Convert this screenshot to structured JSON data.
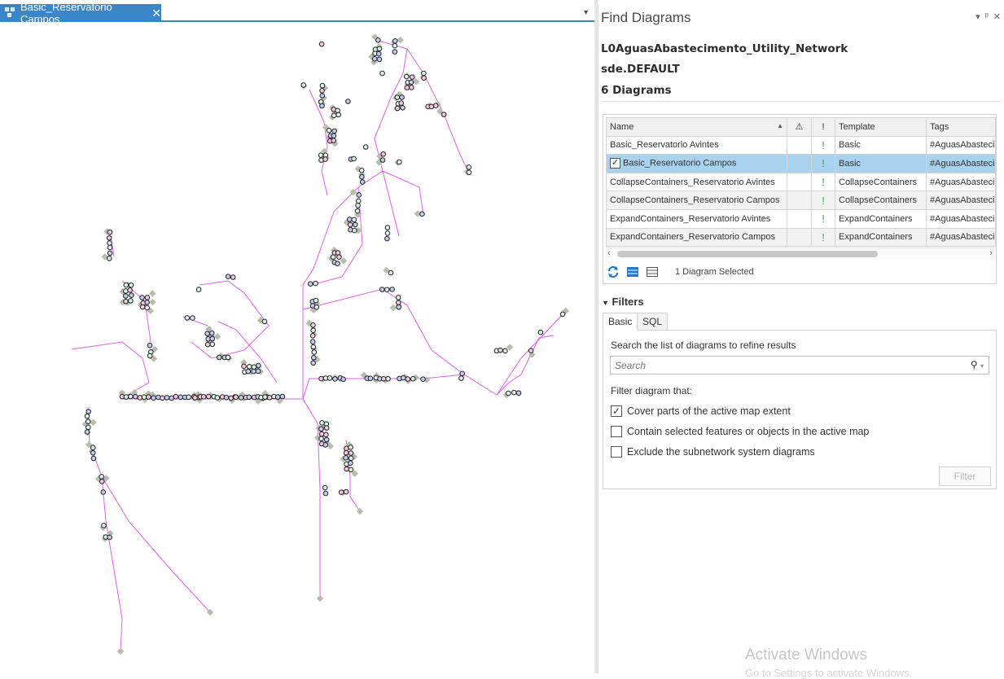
{
  "document_tab": {
    "title": "Basic_Reservatorio Campos",
    "close": "✕"
  },
  "side_pane": {
    "title": "Find Diagrams",
    "header_buttons": [
      "▾",
      "ᵖ",
      "✕"
    ],
    "network": "L0AguasAbastecimento_Utility_Network",
    "version": "sde.DEFAULT",
    "count": "6 Diagrams",
    "grid": {
      "columns": [
        "Name",
        "⚠",
        "!",
        "Template",
        "Tags"
      ],
      "rows": [
        {
          "name": "Basic_Reservatorio Avintes",
          "status": "!",
          "template": "Basic",
          "tags": "#AguasAbasteci"
        },
        {
          "name": "Basic_Reservatorio Campos",
          "status": "!",
          "template": "Basic",
          "tags": "#AguasAbasteci"
        },
        {
          "name": "CollapseContainers_Reservatorio Avintes",
          "status": "!",
          "template": "CollapseContainers",
          "tags": "#AguasAbasteci"
        },
        {
          "name": "CollapseContainers_Reservatorio Campos",
          "status": "!",
          "template": "CollapseContainers",
          "tags": "#AguasAbasteci"
        },
        {
          "name": "ExpandContainers_Reservatorio Avintes",
          "status": "!",
          "template": "ExpandContainers",
          "tags": "#AguasAbasteci"
        },
        {
          "name": "ExpandContainers_Reservatorio Campos",
          "status": "!",
          "template": "ExpandContainers",
          "tags": "#AguasAbasteci"
        }
      ],
      "selected_count": "1 Diagram Selected"
    },
    "filters": {
      "title": "Filters",
      "tabs": [
        "Basic",
        "SQL"
      ],
      "hint": "Search the list of diagrams to refine results",
      "search_placeholder": "Search",
      "label": "Filter diagram that:",
      "options": [
        {
          "label": "Cover parts of the active map extent",
          "checked": true
        },
        {
          "label": "Contain selected features or objects in the active map",
          "checked": false
        },
        {
          "label": "Exclude the subnetwork system diagrams",
          "checked": false
        }
      ],
      "button": "Filter"
    },
    "watermark": {
      "title": "Activate Windows",
      "subtitle": "Go to Settings to activate Windows."
    }
  },
  "colors": {
    "accent": "#3b86c8",
    "selection": "#a9d2ef",
    "line": "#e05cf0",
    "ok": "#34a853"
  }
}
